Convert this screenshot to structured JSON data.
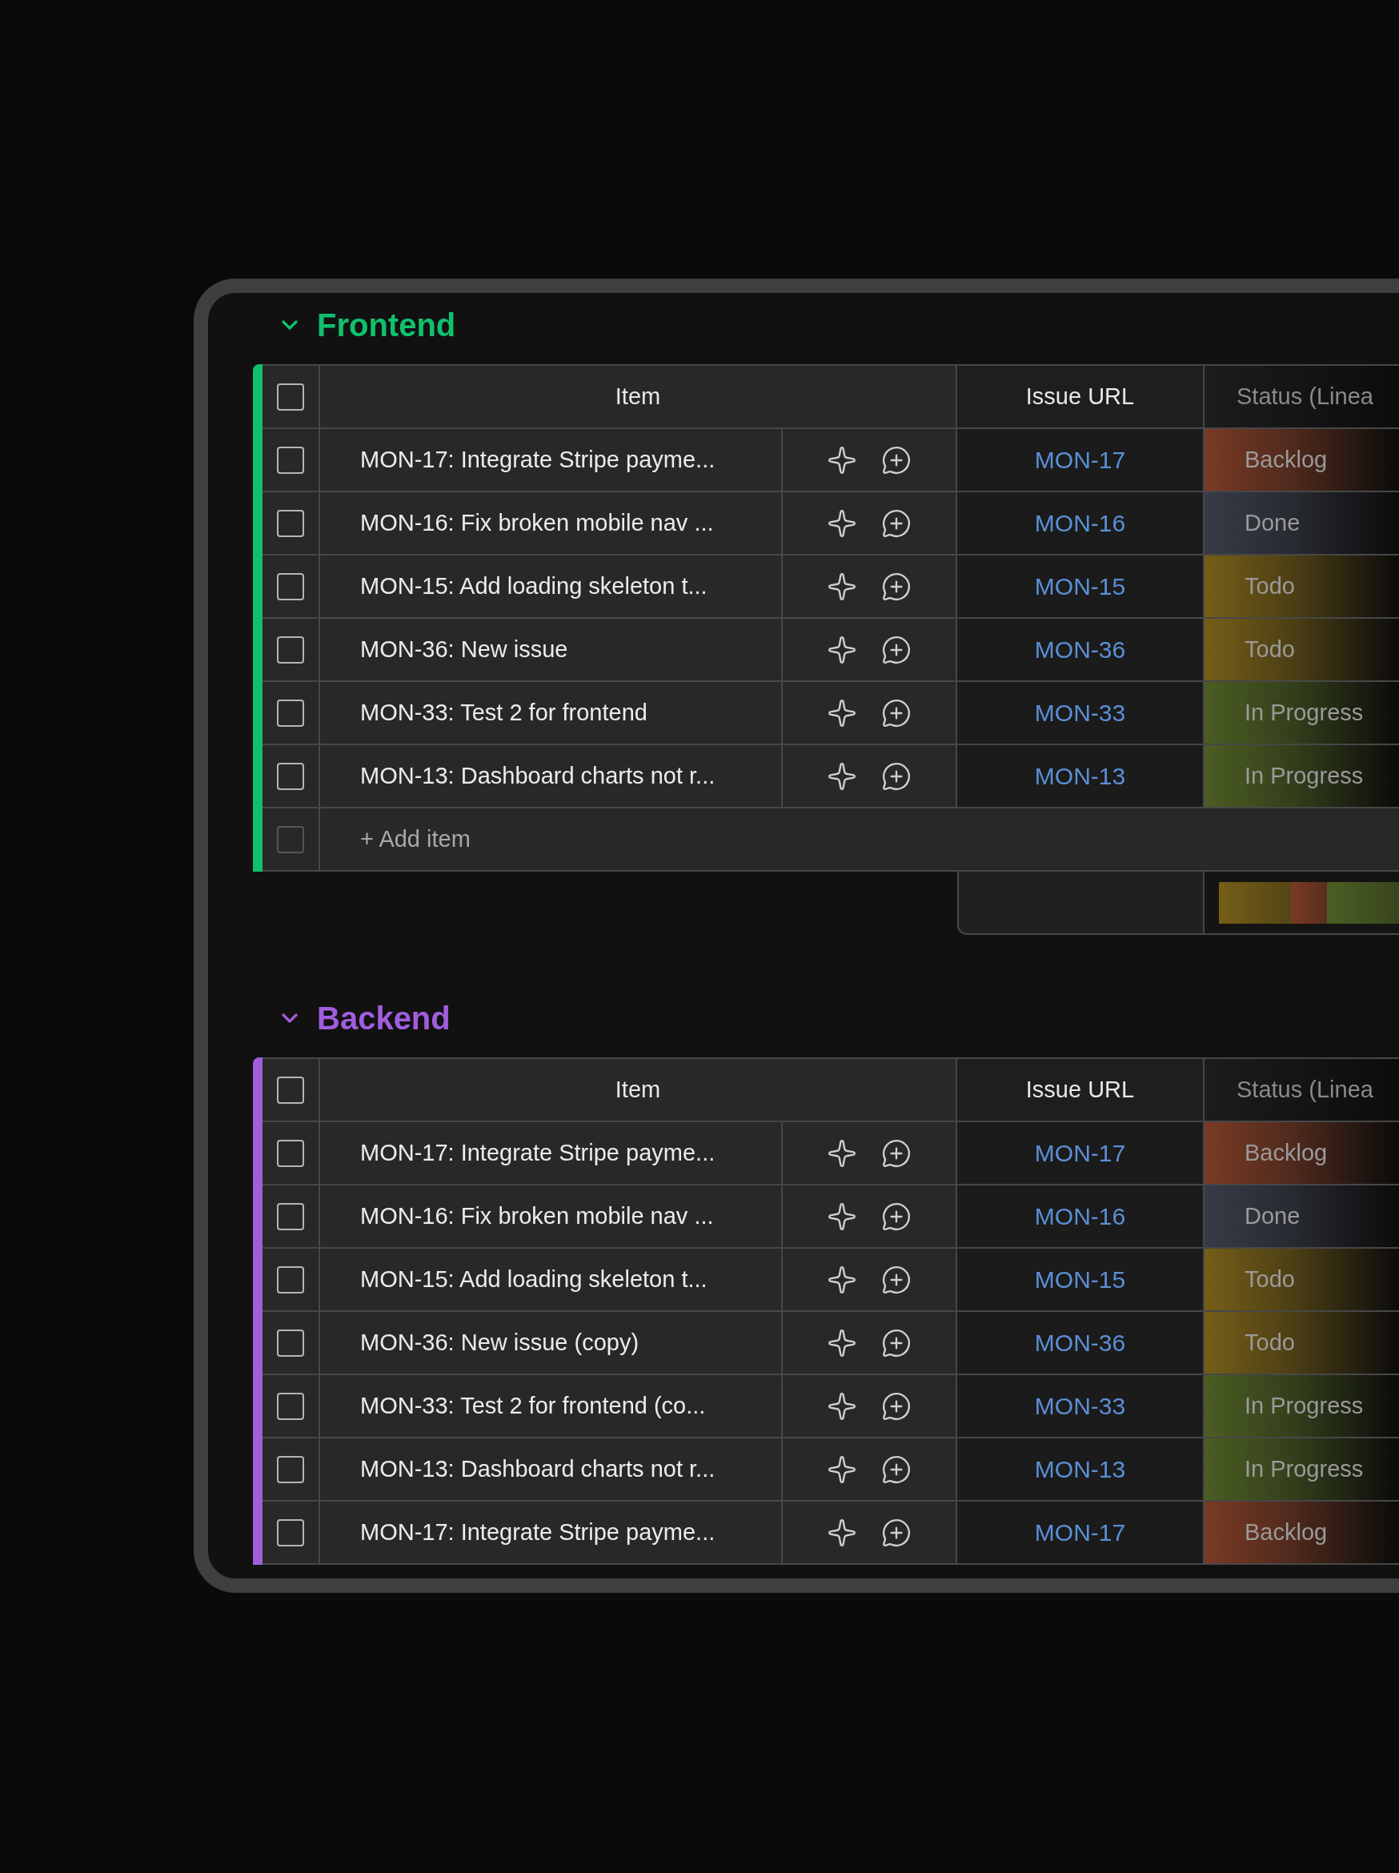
{
  "groups": [
    {
      "title": "Frontend",
      "color": "#0fc16c",
      "expanded": true,
      "columns": [
        "Item",
        "Issue URL",
        "Status (Linea"
      ],
      "header_checkbox": {
        "checked": false
      },
      "rows": [
        {
          "item": "MON-17: Integrate Stripe payme...",
          "issue": "MON-17",
          "status": {
            "label": "Backlog",
            "color": "#7a3a24"
          },
          "checked": false
        },
        {
          "item": "MON-16: Fix broken mobile nav ...",
          "issue": "MON-16",
          "status": {
            "label": "Done",
            "color": "#383b47"
          },
          "checked": false
        },
        {
          "item": "MON-15: Add loading skeleton t...",
          "issue": "MON-15",
          "status": {
            "label": "Todo",
            "color": "#755e17"
          },
          "checked": false
        },
        {
          "item": "MON-36: New issue",
          "issue": "MON-36",
          "status": {
            "label": "Todo",
            "color": "#755e17"
          },
          "checked": false
        },
        {
          "item": "MON-33: Test 2 for frontend",
          "issue": "MON-33",
          "status": {
            "label": "In Progress",
            "color": "#4b5e22"
          },
          "checked": false
        },
        {
          "item": "MON-13: Dashboard charts not r...",
          "issue": "MON-13",
          "status": {
            "label": "In Progress",
            "color": "#4b5e22"
          },
          "checked": false
        }
      ],
      "add_item": {
        "label": "+ Add item",
        "checkbox": {
          "checked": false,
          "disabled": true
        }
      },
      "summary": [
        {
          "color": "#755e17"
        },
        {
          "color": "#7a3a24"
        },
        {
          "color": "#4b5e22"
        }
      ]
    },
    {
      "title": "Backend",
      "color": "#a25ddc",
      "expanded": true,
      "columns": [
        "Item",
        "Issue URL",
        "Status (Linea"
      ],
      "header_checkbox": {
        "checked": false
      },
      "rows": [
        {
          "item": "MON-17: Integrate Stripe payme...",
          "issue": "MON-17",
          "status": {
            "label": "Backlog",
            "color": "#7a3a24"
          },
          "checked": false
        },
        {
          "item": "MON-16: Fix broken mobile nav ...",
          "issue": "MON-16",
          "status": {
            "label": "Done",
            "color": "#383b47"
          },
          "checked": false
        },
        {
          "item": "MON-15: Add loading skeleton t...",
          "issue": "MON-15",
          "status": {
            "label": "Todo",
            "color": "#755e17"
          },
          "checked": false
        },
        {
          "item": "MON-36: New issue (copy)",
          "issue": "MON-36",
          "status": {
            "label": "Todo",
            "color": "#755e17"
          },
          "checked": false
        },
        {
          "item": "MON-33: Test 2 for frontend (co...",
          "issue": "MON-33",
          "status": {
            "label": "In Progress",
            "color": "#4b5e22"
          },
          "checked": false
        },
        {
          "item": "MON-13: Dashboard charts not r...",
          "issue": "MON-13",
          "status": {
            "label": "In Progress",
            "color": "#4b5e22"
          },
          "checked": false
        },
        {
          "item": "MON-17: Integrate Stripe payme...",
          "issue": "MON-17",
          "status": {
            "label": "Backlog",
            "color": "#7a3a24"
          },
          "checked": false
        }
      ]
    }
  ]
}
